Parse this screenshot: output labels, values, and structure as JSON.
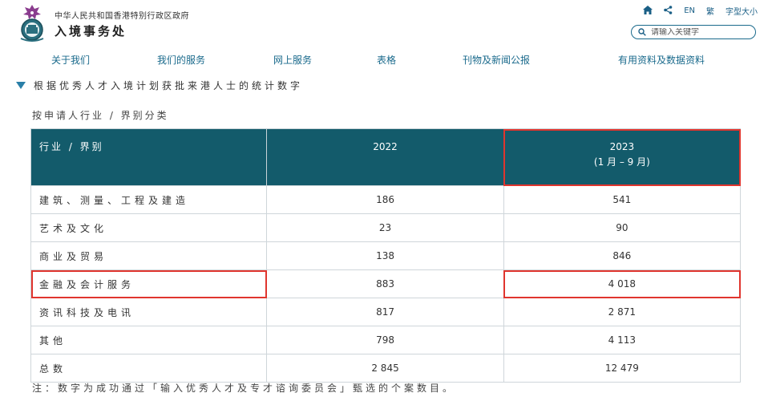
{
  "header": {
    "gov_name": "中华人民共和国香港特别行政区政府",
    "dept_name": "入境事务处",
    "lang_label": "EN",
    "trad_label": "繁",
    "font_size_label": "字型大小",
    "search_placeholder": "请输入关键字"
  },
  "nav": [
    "关于我们",
    "我们的服务",
    "网上服务",
    "表格",
    "刊物及新闻公报",
    "有用资料及数据资料"
  ],
  "section_title": "根据优秀人才入境计划获批来港人士的统计数字",
  "subtitle": "按申请人行业 / 界别分类",
  "table": {
    "headers": [
      "行业 / 界别",
      "2022",
      "2023",
      "(1 月 – 9 月)"
    ],
    "rows": [
      [
        "建筑、测量、工程及建造",
        "186",
        "541"
      ],
      [
        "艺术及文化",
        "23",
        "90"
      ],
      [
        "商业及贸易",
        "138",
        "846"
      ],
      [
        "金融及会计服务",
        "883",
        "4 018"
      ],
      [
        "资讯科技及电讯",
        "817",
        "2 871"
      ],
      [
        "其他",
        "798",
        "4 113"
      ],
      [
        "总数",
        "2 845",
        "12 479"
      ]
    ]
  },
  "note": "注：数字为成功通过「输入优秀人才及专才谘询委员会」甄选的个案数目。",
  "colors": {
    "header_bg": "#135b6b",
    "link": "#1a6a8c",
    "highlight": "#e0352e"
  },
  "icons": [
    "emblem-icon",
    "home-icon",
    "share-icon",
    "search-icon"
  ]
}
